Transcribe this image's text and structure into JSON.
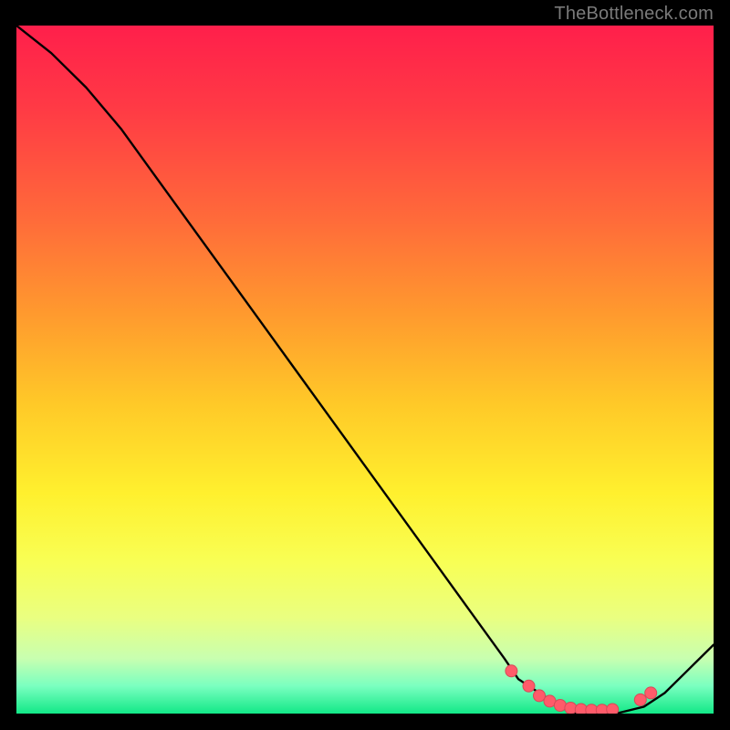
{
  "attribution": "TheBottleneck.com",
  "colors": {
    "frame": "#000000",
    "curve": "#000000",
    "dot_fill": "#ff5b6a",
    "dot_stroke": "#d64a58"
  },
  "chart_data": {
    "type": "line",
    "title": "",
    "xlabel": "",
    "ylabel": "",
    "xlim": [
      0,
      100
    ],
    "ylim": [
      0,
      100
    ],
    "series": [
      {
        "name": "bottleneck-curve",
        "x": [
          0,
          5,
          10,
          15,
          20,
          25,
          30,
          35,
          40,
          45,
          50,
          55,
          60,
          65,
          70,
          72,
          75,
          78,
          80,
          83,
          86,
          90,
          93,
          96,
          100
        ],
        "y": [
          100,
          96,
          91,
          85,
          78,
          71,
          64,
          57,
          50,
          43,
          36,
          29,
          22,
          15,
          8,
          5,
          3,
          1,
          0,
          0,
          0,
          1,
          3,
          6,
          10
        ]
      }
    ],
    "dots": {
      "name": "highlight-dots",
      "x": [
        71,
        73.5,
        75,
        76.5,
        78,
        79.5,
        81,
        82.5,
        84,
        85.5,
        89.5,
        91
      ],
      "y": [
        6.2,
        4.0,
        2.6,
        1.8,
        1.2,
        0.8,
        0.6,
        0.5,
        0.5,
        0.6,
        2.0,
        3.0
      ]
    }
  }
}
